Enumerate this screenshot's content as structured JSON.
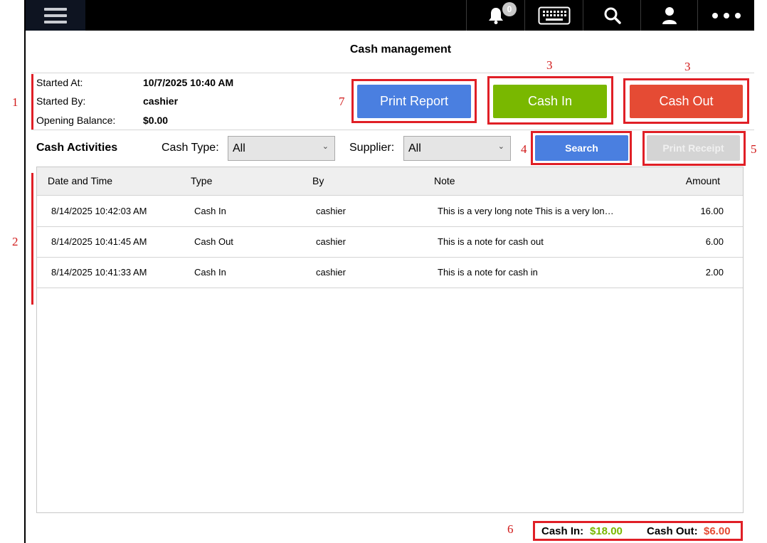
{
  "topbar": {
    "notification_count": "0",
    "icons": [
      "menu-icon",
      "bell-icon",
      "keyboard-icon",
      "search-icon",
      "user-icon",
      "more-icon"
    ]
  },
  "page": {
    "title": "Cash management"
  },
  "session": {
    "started_at_label": "Started At:",
    "started_at": "10/7/2025 10:40 AM",
    "started_by_label": "Started By:",
    "started_by": "cashier",
    "opening_balance_label": "Opening Balance:",
    "opening_balance": "$0.00"
  },
  "actions": {
    "print_report": "Print Report",
    "cash_in": "Cash In",
    "cash_out": "Cash Out",
    "search": "Search",
    "print_receipt": "Print Receipt"
  },
  "filters": {
    "section_title": "Cash Activities",
    "cash_type_label": "Cash Type:",
    "cash_type_value": "All",
    "supplier_label": "Supplier:",
    "supplier_value": "All"
  },
  "table": {
    "columns": [
      "Date and Time",
      "Type",
      "By",
      "Note",
      "Amount"
    ],
    "rows": [
      {
        "datetime": "8/14/2025 10:42:03 AM",
        "type": "Cash In",
        "by": "cashier",
        "note": "This is a very long note This is a very lon…",
        "amount": "16.00"
      },
      {
        "datetime": "8/14/2025 10:41:45 AM",
        "type": "Cash Out",
        "by": "cashier",
        "note": "This is a note for cash out",
        "amount": "6.00"
      },
      {
        "datetime": "8/14/2025 10:41:33 AM",
        "type": "Cash In",
        "by": "cashier",
        "note": "This is a note for cash in",
        "amount": "2.00"
      }
    ]
  },
  "totals": {
    "cash_in_label": "Cash In:",
    "cash_in": "$18.00",
    "cash_out_label": "Cash Out:",
    "cash_out": "$6.00"
  },
  "annotations": {
    "a1": "1",
    "a2": "2",
    "a3_left": "3",
    "a3_right": "3",
    "a4": "4",
    "a5": "5",
    "a6": "6",
    "a7": "7"
  },
  "colors": {
    "accent_blue": "#4a7fe0",
    "cash_in_green": "#79b800",
    "cash_out_red": "#e54b34",
    "annotation_red": "#e01f26",
    "topbar_bg": "#000000"
  }
}
